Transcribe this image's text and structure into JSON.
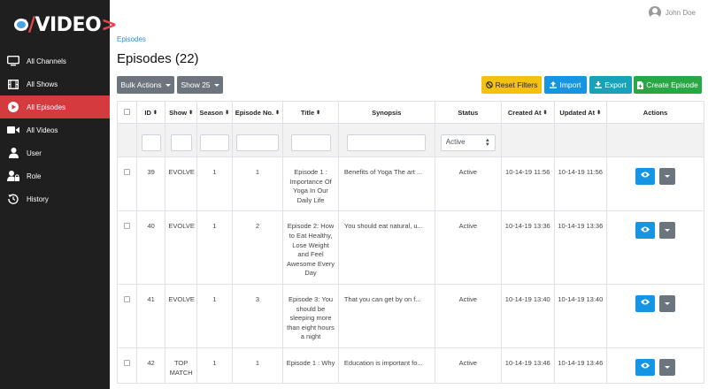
{
  "brand": {
    "logo_text": "</VIDEO>",
    "accent": "#d33b3f"
  },
  "user": {
    "name": "John Doe"
  },
  "sidebar": {
    "items": [
      {
        "label": "All Channels",
        "icon": "monitor-icon",
        "active": false
      },
      {
        "label": "All Shows",
        "icon": "film-icon",
        "active": false
      },
      {
        "label": "All Episodes",
        "icon": "play-circle-icon",
        "active": true
      },
      {
        "label": "All Videos",
        "icon": "video-camera-icon",
        "active": false
      },
      {
        "label": "User",
        "icon": "user-icon",
        "active": false
      },
      {
        "label": "Role",
        "icon": "user-lock-icon",
        "active": false
      },
      {
        "label": "History",
        "icon": "history-icon",
        "active": false
      }
    ]
  },
  "breadcrumb": "Episodes",
  "page_title": "Episodes (22)",
  "toolbar": {
    "bulk_actions": "Bulk Actions",
    "show_count": "Show 25",
    "reset_filters": "Reset Filters",
    "import": "Import",
    "export": "Export",
    "create": "Create Episode"
  },
  "table": {
    "columns": [
      "ID",
      "Show",
      "Season",
      "Episode No.",
      "Title",
      "Synopsis",
      "Status",
      "Created At",
      "Updated At",
      "Actions"
    ],
    "status_filter": "Active",
    "rows": [
      {
        "id": "39",
        "show": "EVOLVE",
        "season": "1",
        "episode_no": "1",
        "title": "Episode 1 : Importance Of Yoga In Our Daily Life",
        "synopsis": "Benefits of Yoga The art ...",
        "status": "Active",
        "created": "10-14-19 11:56",
        "updated": "10-14-19 11:56"
      },
      {
        "id": "40",
        "show": "EVOLVE",
        "season": "1",
        "episode_no": "2",
        "title": "Episode 2: How to Eat Healthy, Lose Weight and Feel Awesome Every Day",
        "synopsis": "You should eat natural, u...",
        "status": "Active",
        "created": "10-14-19 13:36",
        "updated": "10-14-19 13:36"
      },
      {
        "id": "41",
        "show": "EVOLVE",
        "season": "1",
        "episode_no": "3",
        "title": "Episode 3: You should be sleeping more than eight hours a night",
        "synopsis": "That you can get by on f...",
        "status": "Active",
        "created": "10-14-19 13:40",
        "updated": "10-14-19 13:40"
      },
      {
        "id": "42",
        "show": "TOP MATCH",
        "season": "1",
        "episode_no": "1",
        "title": "Episode 1 : Why",
        "synopsis": "Education is important fo...",
        "status": "Active",
        "created": "10-14-19 13:46",
        "updated": "10-14-19 13:46"
      }
    ]
  }
}
